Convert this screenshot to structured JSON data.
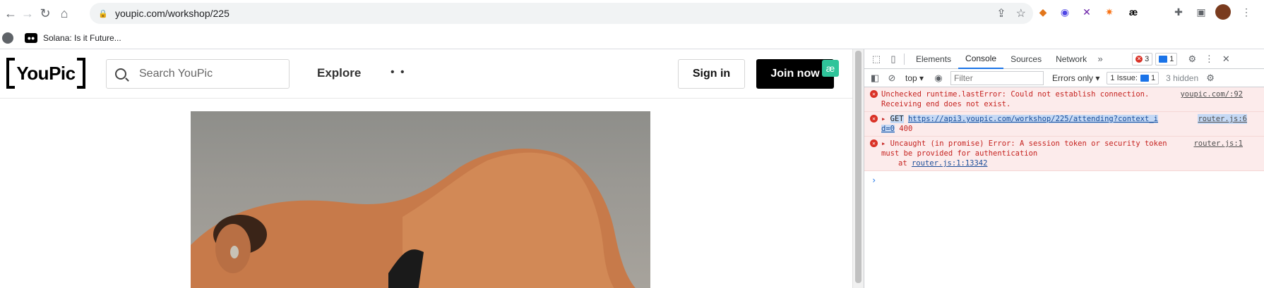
{
  "browser": {
    "url": "youpic.com/workshop/225",
    "bookmark_label": "Solana: Is it Future...",
    "ext_ae_label": "æ"
  },
  "site": {
    "logo_text": "YouPic",
    "search_placeholder": "Search YouPic",
    "explore_label": "Explore",
    "more_label": "• •",
    "signin_label": "Sign in",
    "join_label": "Join now",
    "ae_badge": "æ"
  },
  "devtools": {
    "tabs": [
      "Elements",
      "Console",
      "Sources",
      "Network"
    ],
    "more_tabs": "»",
    "error_count": "3",
    "message_count": "1",
    "context": "top",
    "filter_placeholder": "Filter",
    "level": "Errors only",
    "issues": "1 Issue:",
    "issues_count": "1",
    "hidden": "3 hidden",
    "messages": [
      {
        "text1": "Unchecked runtime.lastError: Could not establish connection.",
        "text2": "Receiving end does not exist.",
        "source": "youpic.com/:92"
      },
      {
        "method": "GET",
        "url1": "https://api3.youpic.com/workshop/225/attending?context_i",
        "url2": "d=0",
        "status": "400",
        "source": "router.js:6"
      },
      {
        "text1": "Uncaught (in promise) Error: A session token or security token",
        "text2": "must be provided for authentication",
        "text3_prefix": "at",
        "text3_link": "router.js:1:13342",
        "source": "router.js:1"
      }
    ],
    "prompt": "›"
  }
}
